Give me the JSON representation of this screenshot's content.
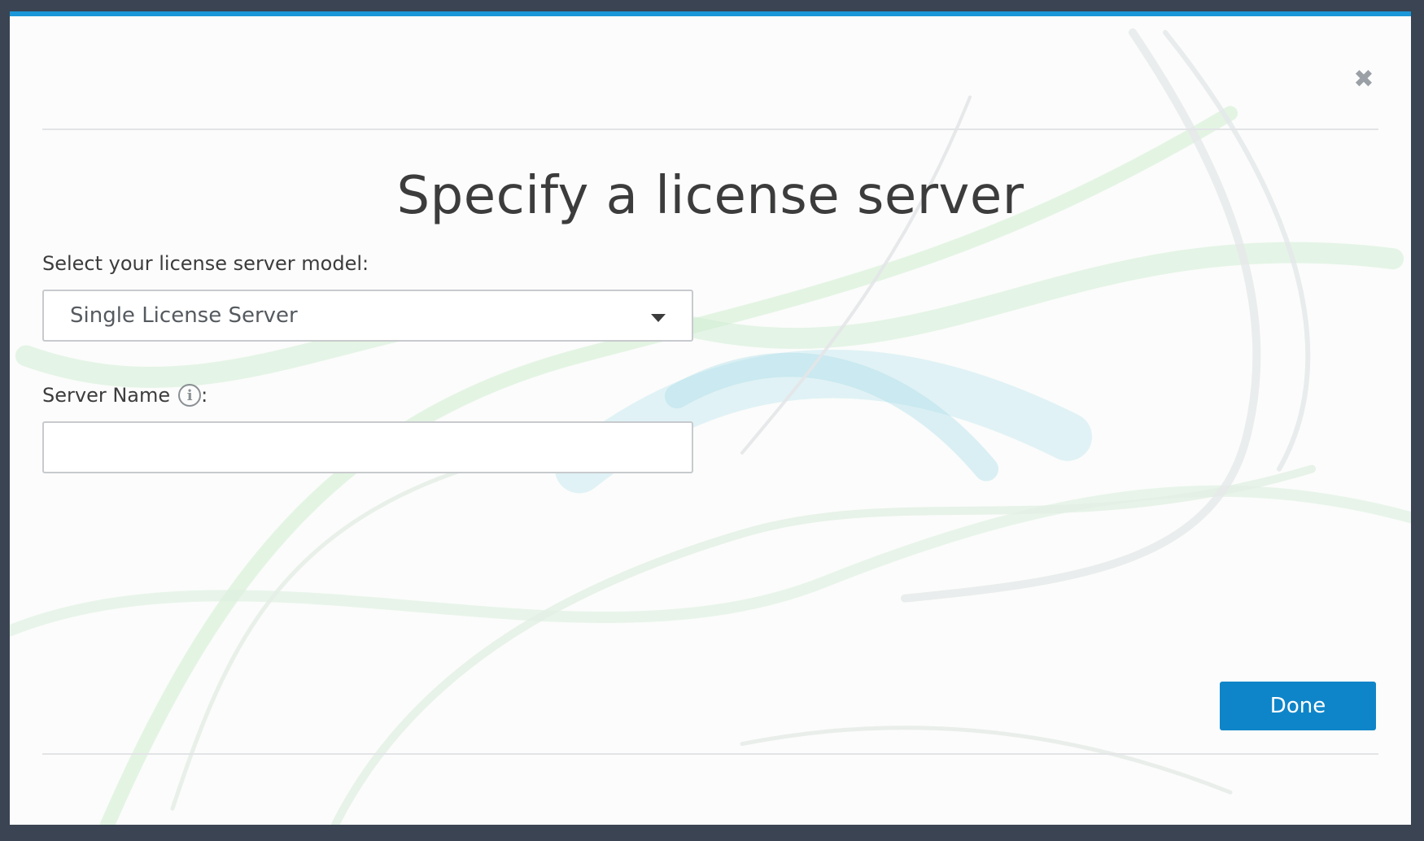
{
  "dialog": {
    "title": "Specify a license server",
    "close_glyph": "✖",
    "close_icon": "close-icon",
    "accent_color": "#1a97d8"
  },
  "form": {
    "model_label": "Select your license server model:",
    "model_selected": "Single License Server",
    "server_name_label": "Server Name",
    "server_name_suffix": ":",
    "server_name_info_icon": "info-icon",
    "server_name_info_glyph": "i",
    "server_name_value": ""
  },
  "footer": {
    "done_label": "Done",
    "done_color": "#0f85c9"
  }
}
